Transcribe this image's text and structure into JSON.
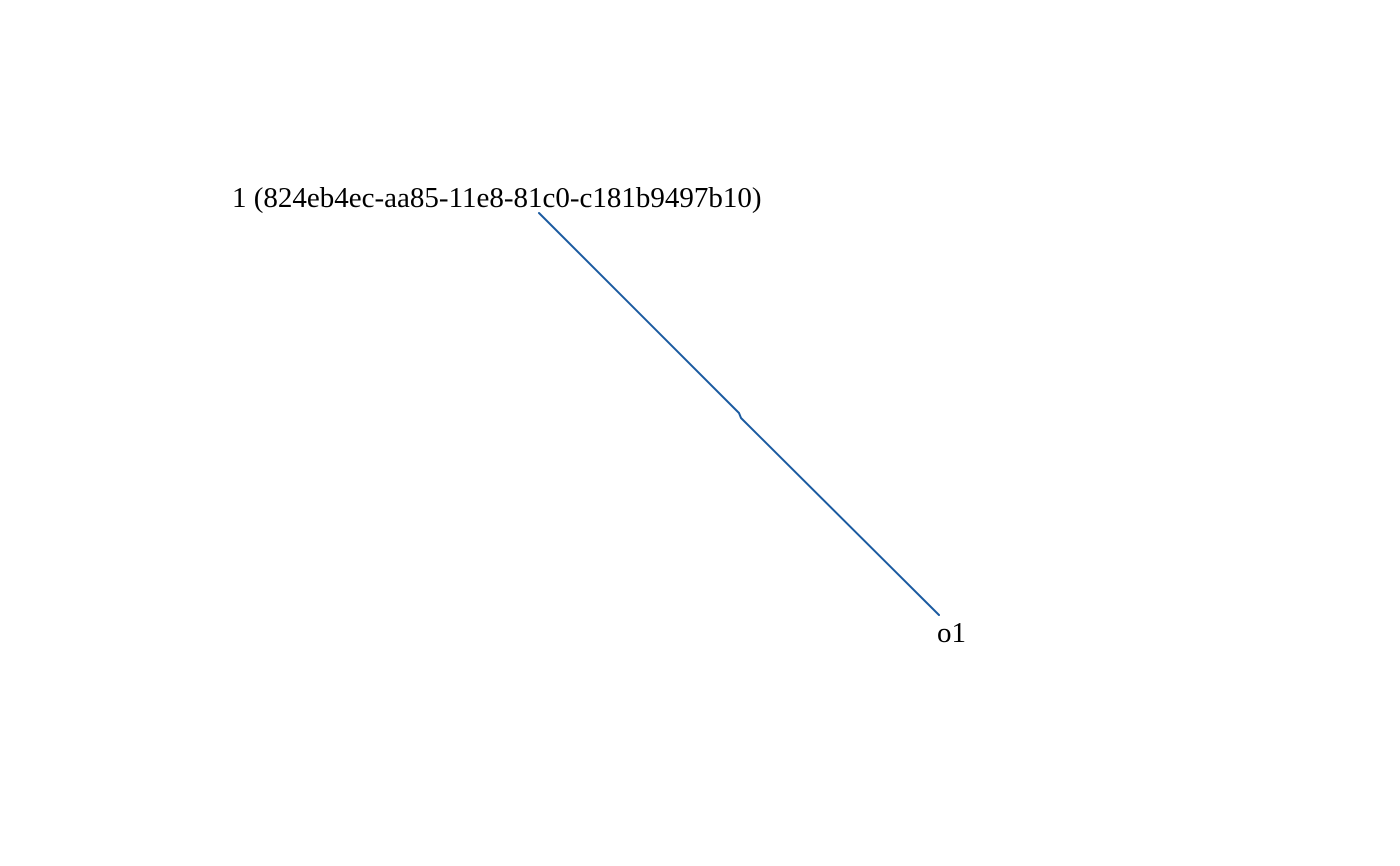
{
  "diagram": {
    "nodes": [
      {
        "id": "root",
        "label": "1 (824eb4ec-aa85-11e8-81c0-c181b9497b10)"
      },
      {
        "id": "child",
        "label": "o1"
      }
    ],
    "edges": [
      {
        "from": "root",
        "to": "child"
      }
    ],
    "colors": {
      "edge": "#1a5aa0",
      "text": "#000000",
      "background": "#ffffff"
    }
  }
}
